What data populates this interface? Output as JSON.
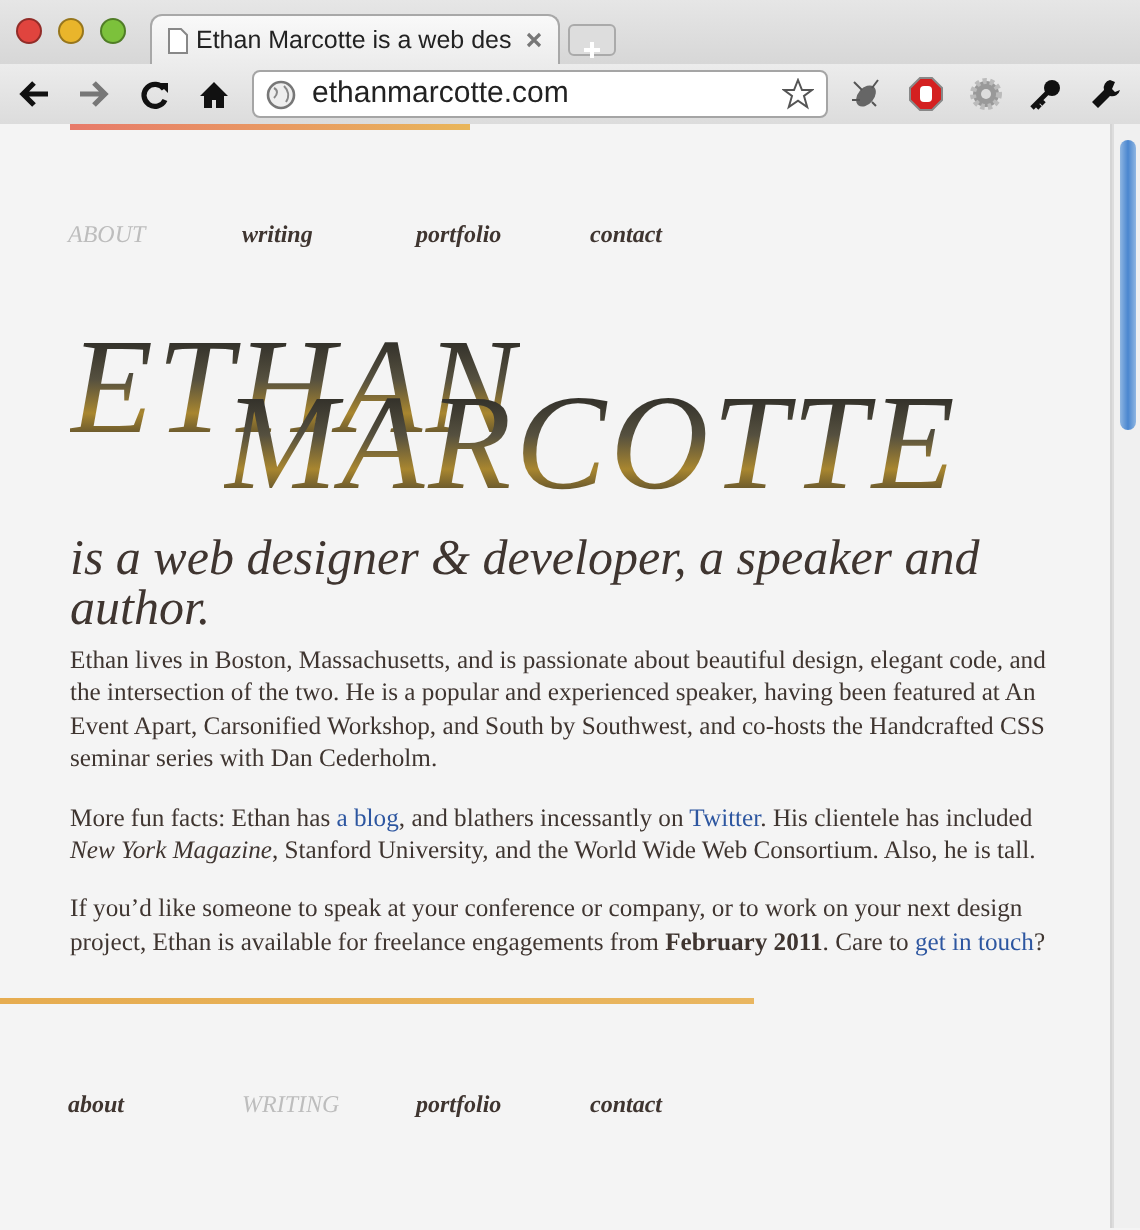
{
  "browser": {
    "tab_title": "Ethan Marcotte is a web des",
    "url": "ethanmarcotte.com"
  },
  "nav_top": [
    {
      "label": "ABOUT",
      "selected": true
    },
    {
      "label": "writing",
      "selected": false
    },
    {
      "label": "portfolio",
      "selected": false
    },
    {
      "label": "contact",
      "selected": false
    }
  ],
  "title": {
    "first": "ETHAN",
    "last": "MARCOTTE"
  },
  "tagline": "is a web designer & developer, a speaker and author.",
  "paragraphs": [
    [
      {
        "kind": "text",
        "text": "Ethan lives in Boston, Massachusetts, and is passionate about beautiful design, elegant code, and the intersection of the two. He is a popular and experienced speaker, having been featured at An Event Apart, Carsonified Workshop, and South by Southwest, and co-hosts the Handcrafted CSS seminar series with Dan Cederholm."
      }
    ],
    [
      {
        "kind": "text",
        "text": "More fun facts: Ethan has "
      },
      {
        "kind": "link",
        "text": "a blog"
      },
      {
        "kind": "text",
        "text": ", and blathers incessantly on "
      },
      {
        "kind": "link",
        "text": "Twitter"
      },
      {
        "kind": "text",
        "text": ". His clientele has included *New York Magazine*, Stanford University, and the World Wide Web Consortium. Also, he is tall."
      }
    ],
    [
      {
        "kind": "text",
        "text": "If you’d like someone to speak at your conference or company, or to work on your next design project, Ethan is available for freelance engagements from **February 2011**. Care to "
      },
      {
        "kind": "link",
        "text": "get in touch"
      },
      {
        "kind": "text",
        "text": "?"
      }
    ]
  ],
  "nav_bottom": [
    {
      "label": "about",
      "selected": false
    },
    {
      "label": "WRITING",
      "selected": true
    },
    {
      "label": "portfolio",
      "selected": false
    },
    {
      "label": "contact",
      "selected": false
    }
  ]
}
